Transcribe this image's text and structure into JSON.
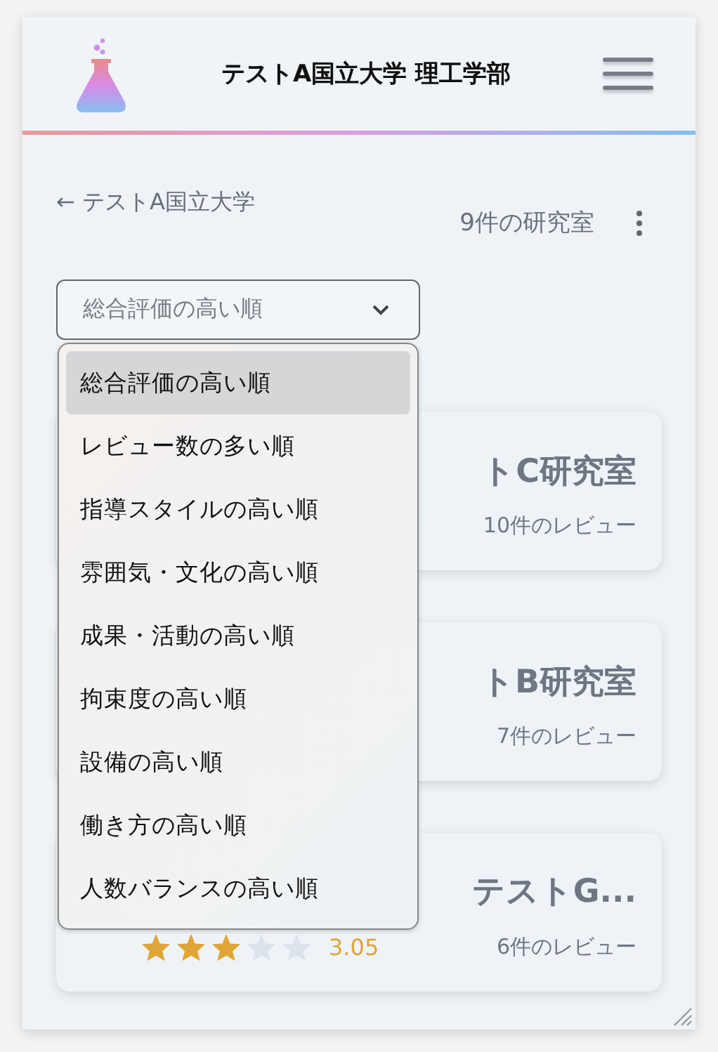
{
  "header": {
    "title": "テストA国立大学 理工学部"
  },
  "back_link": "← テストA国立大学",
  "count": "9件の研究室",
  "sort_select": {
    "value": "総合評価の高い順",
    "expanded": true
  },
  "sort_options": [
    {
      "label": "総合評価の高い順",
      "selected": true
    },
    {
      "label": "レビュー数の多い順",
      "selected": false
    },
    {
      "label": "指導スタイルの高い順",
      "selected": false
    },
    {
      "label": "雰囲気・文化の高い順",
      "selected": false
    },
    {
      "label": "成果・活動の高い順",
      "selected": false
    },
    {
      "label": "拘束度の高い順",
      "selected": false
    },
    {
      "label": "設備の高い順",
      "selected": false
    },
    {
      "label": "働き方の高い順",
      "selected": false
    },
    {
      "label": "人数バランスの高い順",
      "selected": false
    }
  ],
  "labs": [
    {
      "title": "トC研究室",
      "reviews": "10件のレビュー"
    },
    {
      "title": "トB研究室",
      "reviews": "7件のレビュー"
    },
    {
      "title": "テストG...",
      "stars": 3,
      "rating": "3.05",
      "reviews": "6件のレビュー"
    }
  ]
}
